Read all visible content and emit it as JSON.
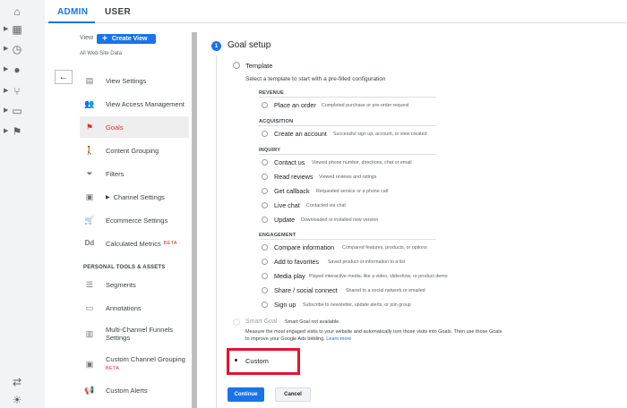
{
  "tabs": {
    "admin": "ADMIN",
    "user": "USER"
  },
  "left": {
    "view_label": "View",
    "create_view": "Create View",
    "site_name": "All Web Site Data",
    "menu": [
      {
        "label": "View Settings",
        "icon": "document-icon"
      },
      {
        "label": "View Access Management",
        "icon": "people-icon"
      },
      {
        "label": "Goals",
        "icon": "flag-icon",
        "active": true
      },
      {
        "label": "Content Grouping",
        "icon": "walking-icon"
      },
      {
        "label": "Filters",
        "icon": "funnel-icon"
      },
      {
        "label": "Channel Settings",
        "icon": "channel-icon"
      },
      {
        "label": "Ecommerce Settings",
        "icon": "cart-icon"
      },
      {
        "label": "Calculated Metrics",
        "icon": "dd-icon",
        "badge": "BETA"
      }
    ],
    "section_personal": "PERSONAL TOOLS & ASSETS",
    "menu2": [
      {
        "label": "Segments",
        "icon": "segments-icon"
      },
      {
        "label": "Annotations",
        "icon": "annotation-icon"
      },
      {
        "label": "Multi-Channel Funnels",
        "label2": "Settings",
        "icon": "bar-chart-icon"
      },
      {
        "label": "Custom Channel Grouping",
        "icon": "grouping-icon",
        "badge": "BETA"
      },
      {
        "label": "Custom Alerts",
        "icon": "megaphone-icon"
      }
    ]
  },
  "goal": {
    "step_number": "1",
    "title": "Goal setup",
    "template_label": "Template",
    "template_desc": "Select a template to start with a pre-filled configuration",
    "categories": {
      "revenue": "REVENUE",
      "acquisition": "ACQUISITION",
      "inquiry": "INQUIRY",
      "engagement": "ENGAGEMENT"
    },
    "revenue": [
      {
        "label": "Place an order",
        "desc": "Completed purchase or pre-order request"
      }
    ],
    "acquisition": [
      {
        "label": "Create an account",
        "desc": "Successful sign up, account, or view created"
      }
    ],
    "inquiry": [
      {
        "label": "Contact us",
        "desc": "Viewed phone number, directions, chat or email"
      },
      {
        "label": "Read reviews",
        "desc": "Viewed reviews and ratings"
      },
      {
        "label": "Get callback",
        "desc": "Requested service or a phone call"
      },
      {
        "label": "Live chat",
        "desc": "Contacted via chat"
      },
      {
        "label": "Update",
        "desc": "Downloaded or installed new version"
      }
    ],
    "engagement": [
      {
        "label": "Compare information",
        "desc": "Compared features, products, or options"
      },
      {
        "label": "Add to favorites",
        "desc": "Saved product or information to a list"
      },
      {
        "label": "Media play",
        "desc": "Played interactive media, like a video, slideshow, or product demo"
      },
      {
        "label": "Share / social connect",
        "desc": "Shared to a social network or emailed"
      },
      {
        "label": "Sign up",
        "desc": "Subscribe to newsletter, update alerts, or join group"
      }
    ],
    "smart_goal": "Smart Goal",
    "smart_na": "Smart Goal not available.",
    "smart_desc": "Measure the most engaged visits to your website and automatically turn those visits into Goals. Then use those Goals to improve your Google Ads bidding.",
    "learn_more": "Learn more",
    "custom_label": "Custom",
    "continue": "Continue",
    "cancel": "Cancel"
  },
  "colors": {
    "accent": "#1a73e8",
    "highlight": "#e8112d",
    "active": "#d93025"
  }
}
